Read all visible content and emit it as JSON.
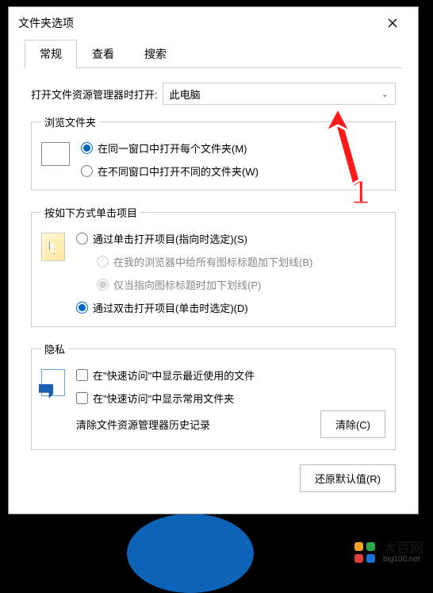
{
  "window": {
    "title": "文件夹选项"
  },
  "tabs": {
    "general": "常规",
    "view": "查看",
    "search": "搜索"
  },
  "open_with": {
    "label": "打开文件资源管理器时打开:",
    "selected": "此电脑"
  },
  "browse": {
    "legend": "浏览文件夹",
    "opt1": "在同一窗口中打开每个文件夹(M)",
    "opt2": "在不同窗口中打开不同的文件夹(W)"
  },
  "click": {
    "legend": "按如下方式单击项目",
    "opt1": "通过单击打开项目(指向时选定)(S)",
    "sub1": "在我的浏览器中给所有图标标题加下划线(B)",
    "sub2": "仅当指向图标标题时加下划线(P)",
    "opt2": "通过双击打开项目(单击时选定)(D)"
  },
  "privacy": {
    "legend": "隐私",
    "chk1": "在\"快速访问\"中显示最近使用的文件",
    "chk2": "在\"快速访问\"中显示常用文件夹",
    "clear_label": "清除文件资源管理器历史记录",
    "clear_btn": "清除(C)"
  },
  "restore_btn": "还原默认值(R)",
  "annotation": {
    "num": "1"
  },
  "watermark": {
    "name": "大百网",
    "url": "big100.net"
  }
}
